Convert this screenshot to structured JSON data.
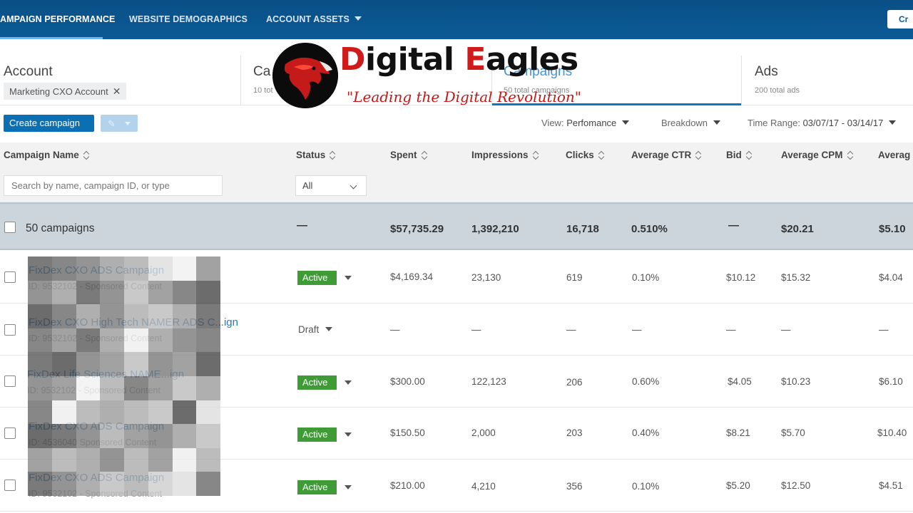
{
  "topnav": {
    "tabs": [
      {
        "label": "AMPAIGN PERFORMANCE",
        "active": true
      },
      {
        "label": "WEBSITE DEMOGRAPHICS",
        "active": false
      },
      {
        "label": "ACCOUNT ASSETS",
        "active": false
      }
    ],
    "create_label": "Cr"
  },
  "summary": {
    "account": {
      "title": "Account",
      "chip": "Marketing CXO Account"
    },
    "campaign_groups": {
      "title": "Ca",
      "sub": "10 tot"
    },
    "campaigns": {
      "title": "Campaigns",
      "sub": "50 total campaigns"
    },
    "ads": {
      "title": "Ads",
      "sub": "200 total ads"
    }
  },
  "logo": {
    "word_red1": "D",
    "word1": "igital ",
    "word_red2": "E",
    "word2": "agles",
    "tagline": "\"Leading the Digital Revolution\""
  },
  "toolbar": {
    "create_label": "Create campaign",
    "view_label": "View:",
    "view_value": "Perfomance",
    "breakdown_label": "Breakdown",
    "timerange_label": "Time Range:",
    "timerange_value": "03/07/17 - 03/14/17"
  },
  "columns": [
    "Campaign Name",
    "Status",
    "Spent",
    "Impressions",
    "Clicks",
    "Average CTR",
    "Bid",
    "Average CPM",
    "Averag"
  ],
  "filters": {
    "search_placeholder": "Search by name, campaign ID, or type",
    "status_value": "All"
  },
  "totals": {
    "label": "50 campaigns",
    "status": "—",
    "spent": "$57,735.29",
    "impressions": "1,392,210",
    "clicks": "16,718",
    "ctr": "0.510%",
    "bid": "—",
    "cpm": "$20.21",
    "avg": "$5.10"
  },
  "rows": [
    {
      "name": "FixDex CXO ADS Campaign",
      "sub": "ID: 9532102 - Sponsored Content",
      "status": "Active",
      "spent": "$4,169.34",
      "impressions": "23,130",
      "clicks": "619",
      "ctr": "0.10%",
      "bid": "$10.12",
      "cpm": "$15.32",
      "avg": "$4.04"
    },
    {
      "name": "FixDex CXO High Tech NAMER ADS C...ign",
      "sub": "ID: 9532102 - Sponsored Content",
      "status": "Draft",
      "spent": "—",
      "impressions": "—",
      "clicks": "—",
      "ctr": "—",
      "bid": "—",
      "cpm": "—",
      "avg": "—"
    },
    {
      "name": "FixDex Life Sciences NAME...ign",
      "sub": "ID: 9532102 - Sponsored Content",
      "status": "Active",
      "spent": "$300.00",
      "impressions": "122,123",
      "clicks": "206",
      "ctr": "0.60%",
      "bid": "$4.05",
      "cpm": "$10.23",
      "avg": "$6.10"
    },
    {
      "name": "FixDex CXO ADS Campaign",
      "sub": "ID: 4536040 Sponsored Content",
      "status": "Active",
      "spent": "$150.50",
      "impressions": "2,000",
      "clicks": "203",
      "ctr": "0.40%",
      "bid": "$8.21",
      "cpm": "$5.70",
      "avg": "$10.40"
    },
    {
      "name": "FixDex CXO ADS Campaign",
      "sub": "ID: 9532102 - Sponsored Content",
      "status": "Active",
      "spent": "$210.00",
      "impressions": "4,210",
      "clicks": "356",
      "ctr": "0.10%",
      "bid": "$5.20",
      "cpm": "$12.50",
      "avg": "$4.51"
    }
  ],
  "colors": {
    "nav": "#0b5b97",
    "active_badge": "#3e9b35",
    "link": "#2b78bd",
    "totals_bg": "#ccd5dc"
  }
}
